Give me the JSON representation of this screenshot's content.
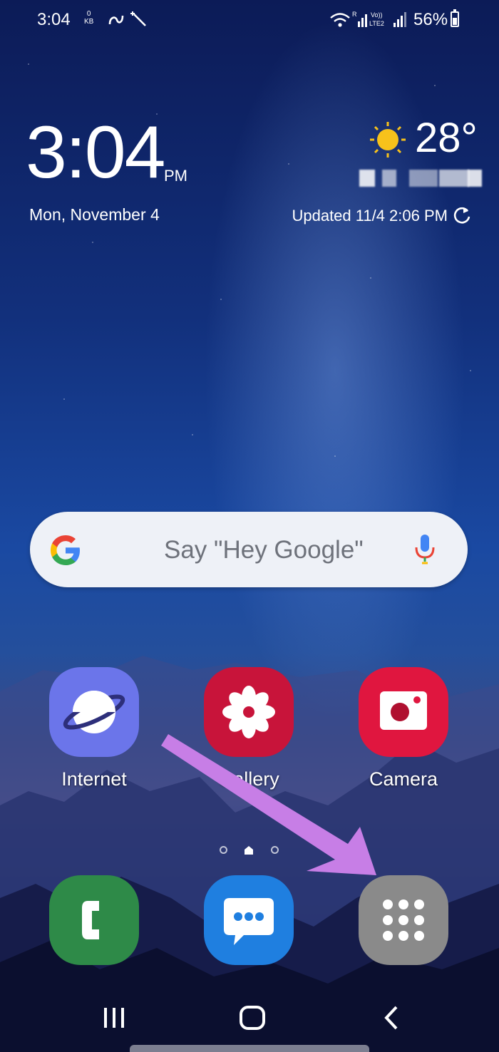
{
  "status_bar": {
    "time": "3:04",
    "data_rate_value": "0",
    "data_rate_unit": "KB",
    "battery_percent": "56%",
    "battery_level": 0.56
  },
  "clock": {
    "time": "3:04",
    "ampm": "PM",
    "date": "Mon, November 4"
  },
  "weather": {
    "temperature": "28°",
    "updated": "Updated 11/4 2:06 PM",
    "icon": "sun-icon"
  },
  "search": {
    "placeholder": "Say \"Hey Google\"",
    "logo": "google-g-logo",
    "voice_icon": "mic-icon"
  },
  "apps_row": [
    {
      "label": "Internet",
      "icon": "planet-icon",
      "color": "#6a74e8"
    },
    {
      "label": "Gallery",
      "icon": "flower-icon",
      "color": "#c8143a"
    },
    {
      "label": "Camera",
      "icon": "camera-icon",
      "color": "#e0163f"
    }
  ],
  "dock": [
    {
      "icon": "phone-icon",
      "color": "#2e8a48"
    },
    {
      "icon": "messages-icon",
      "color": "#1f7fe0"
    },
    {
      "icon": "apps-grid-icon",
      "color": "#8a8a8a"
    }
  ],
  "annotation": {
    "color": "#c77ee6"
  },
  "nav": [
    "recents-icon",
    "home-icon",
    "back-icon"
  ]
}
